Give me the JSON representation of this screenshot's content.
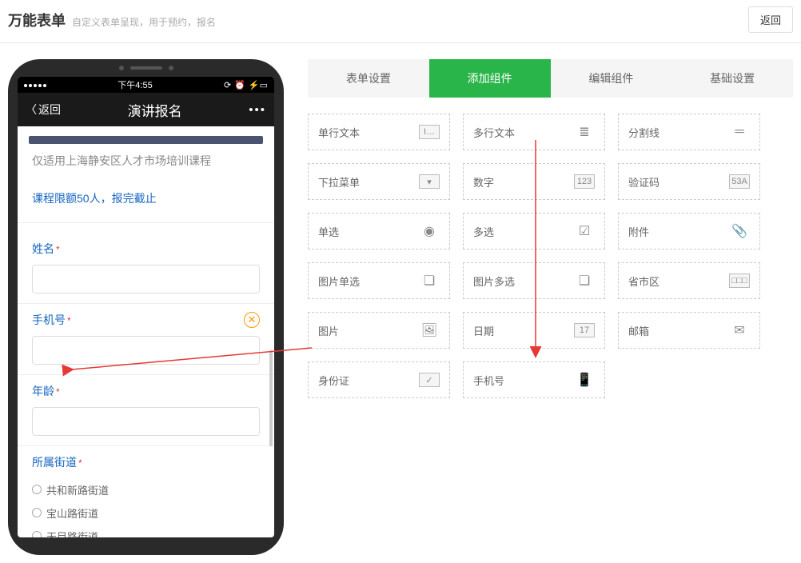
{
  "header": {
    "title": "万能表单",
    "subtitle": "自定义表单呈现，用于预约，报名",
    "back_btn": "返回"
  },
  "phone": {
    "status_time": "下午4:55",
    "nav_back": "返回",
    "nav_title": "演讲报名",
    "form_desc": "仅适用上海静安区人才市场培训课程",
    "form_note": "课程限额50人，报完截止",
    "field_name": "姓名",
    "field_phone": "手机号",
    "field_age": "年龄",
    "field_street": "所属街道",
    "streets": [
      "共和新路街道",
      "宝山路街道",
      "天目路街道"
    ]
  },
  "tabs": [
    "表单设置",
    "添加组件",
    "编辑组件",
    "基础设置"
  ],
  "active_tab": 1,
  "components": [
    [
      {
        "label": "单行文本",
        "icon": "I…"
      },
      {
        "label": "多行文本",
        "icon": "≣",
        "nb": true
      },
      {
        "label": "分割线",
        "icon": "═",
        "nb": true
      }
    ],
    [
      {
        "label": "下拉菜单",
        "icon": "▾"
      },
      {
        "label": "数字",
        "icon": "123"
      },
      {
        "label": "验证码",
        "icon": "53A"
      }
    ],
    [
      {
        "label": "单选",
        "icon": "◉",
        "nb": true
      },
      {
        "label": "多选",
        "icon": "☑",
        "nb": true
      },
      {
        "label": "附件",
        "icon": "📎",
        "nb": true
      }
    ],
    [
      {
        "label": "图片单选",
        "icon": "❏",
        "nb": true
      },
      {
        "label": "图片多选",
        "icon": "❏",
        "nb": true
      },
      {
        "label": "省市区",
        "icon": "□□□"
      }
    ],
    [
      {
        "label": "图片",
        "icon": "🖼",
        "nb": true
      },
      {
        "label": "日期",
        "icon": "17"
      },
      {
        "label": "邮箱",
        "icon": "✉",
        "nb": true
      }
    ],
    [
      {
        "label": "身份证",
        "icon": "✓"
      },
      {
        "label": "手机号",
        "icon": "📱",
        "nb": true
      }
    ]
  ]
}
